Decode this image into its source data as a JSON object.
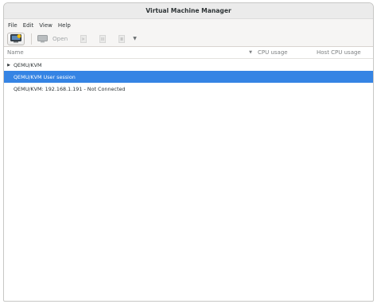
{
  "window": {
    "title": "Virtual Machine Manager"
  },
  "menubar": {
    "items": [
      "File",
      "Edit",
      "View",
      "Help"
    ]
  },
  "toolbar": {
    "open_label": "Open",
    "icons": [
      "new-vm-icon",
      "monitor-icon",
      "play-icon",
      "pause-icon",
      "shutdown-icon",
      "chevron-down-icon"
    ]
  },
  "table": {
    "columns": {
      "name": "Name",
      "cpu": "CPU usage",
      "host_cpu": "Host CPU usage"
    },
    "rows": [
      {
        "label": "QEMU/KVM",
        "expandable": true,
        "selected": false
      },
      {
        "label": "QEMU/KVM User session",
        "expandable": false,
        "selected": true
      },
      {
        "label": "QEMU/KVM: 192.168.1.191 - Not Connected",
        "expandable": false,
        "selected": false
      }
    ]
  },
  "colors": {
    "selection": "#3584e4",
    "titlebar": "#ebebeb",
    "text": "#2e3436"
  }
}
